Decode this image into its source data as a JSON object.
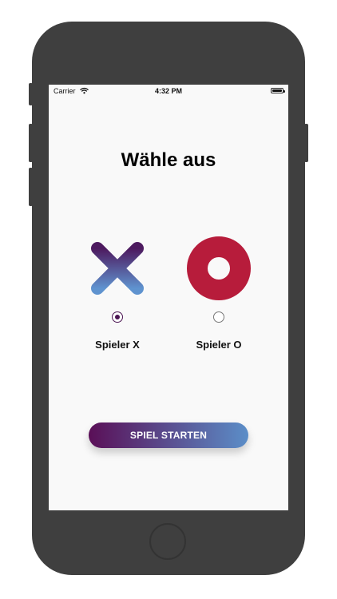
{
  "status_bar": {
    "carrier": "Carrier",
    "time": "4:32 PM"
  },
  "title": "Wähle aus",
  "players": [
    {
      "label": "Spieler X",
      "symbol": "x-piece-icon",
      "selected": true
    },
    {
      "label": "Spieler O",
      "symbol": "o-piece-icon",
      "selected": false
    }
  ],
  "start_button": {
    "label": "SPIEL STARTEN"
  },
  "colors": {
    "x_gradient_start": "#4d1a5f",
    "x_gradient_end": "#5f93cf",
    "o_color": "#b71c3b",
    "button_gradient_start": "#5a0f57",
    "button_gradient_end": "#5b8ec8"
  }
}
